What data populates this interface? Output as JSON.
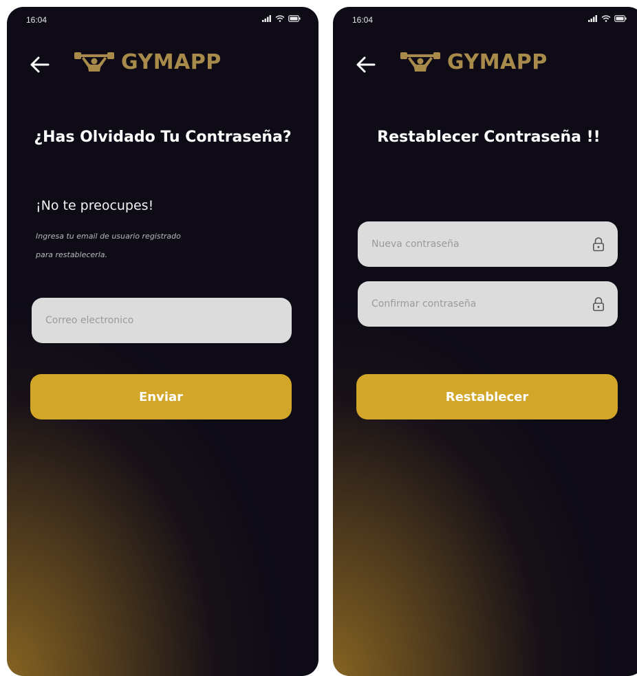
{
  "theme": {
    "accent": "#d2a629",
    "brand_color": "#a88b4b",
    "background": "#0e0b17",
    "input_background": "#dcdcdc"
  },
  "screens": [
    {
      "status_bar": {
        "time": "16:04",
        "icons": [
          "signal-icon",
          "wifi-icon",
          "battery-icon"
        ]
      },
      "header": {
        "back_icon": "arrow-left-icon",
        "logo_icon": "weightlifter-icon",
        "brand": "GYMAPP"
      },
      "title": "¿Has Olvidado Tu Contraseña?",
      "subtitle": "¡No te preocupes!",
      "helper_line1": "Ingresa tu email de usuario registrado",
      "helper_line2": "para restablecerla.",
      "email_input": {
        "placeholder": "Correo electronico",
        "value": ""
      },
      "submit_button": "Enviar"
    },
    {
      "status_bar": {
        "time": "16:04",
        "icons": [
          "signal-icon",
          "wifi-icon",
          "battery-icon"
        ]
      },
      "header": {
        "back_icon": "arrow-left-icon",
        "logo_icon": "weightlifter-icon",
        "brand": "GYMAPP"
      },
      "title": "Restablecer Contraseña !!",
      "new_password_input": {
        "placeholder": "Nueva contraseña",
        "value": "",
        "icon": "lock-icon"
      },
      "confirm_password_input": {
        "placeholder": "Confirmar contraseña",
        "value": "",
        "icon": "lock-icon"
      },
      "submit_button": "Restablecer"
    }
  ]
}
